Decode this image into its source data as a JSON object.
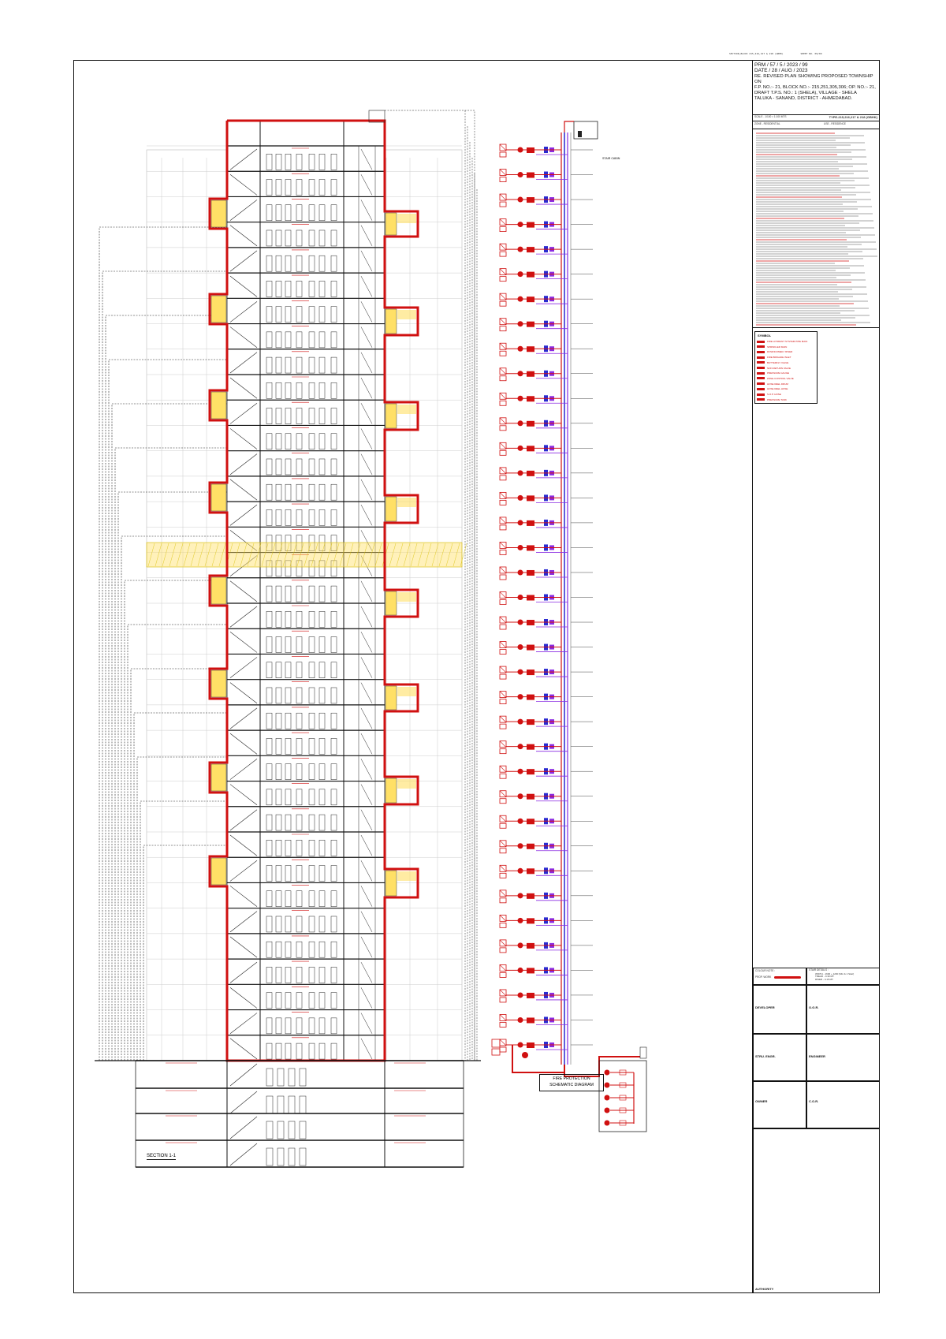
{
  "header_strip": {
    "left": "SECTION_BLOCK 215,216,217 & 218 (GBHK)",
    "right": "SHEET NO. 09/09"
  },
  "title_block": {
    "prm": "PRM / 57 / 5 / 2023 / 99",
    "date": "DATE / 28 / AUG / 2023",
    "project_lines": [
      "RE. REVISED PLAN SHOWING PROPOSED TOWNSHIP ON",
      "F.P. NO.:- 21, BLOCK NO.:- 215,251,305,306; OP. NO.:- 21,",
      "DRAFT T.P.S. NO.: 1 (SHELA), VILLAGE - SHELA",
      "TALUKA - SANAND, DISTRICT - AHMEDABAD."
    ],
    "scale": "SCALE - 1/100 = 1:100 MTS",
    "type": "TYPE-215,216,217 & 218 (GBHK)",
    "zone": "ZONE - RESIDENTIAL",
    "use": "USE - RESIDENCE",
    "colour_note_label": "COLOUR NOTE :",
    "prop_work_label": "PROP. WORK",
    "stair_details_label": "STAIR DETAILS :",
    "stair_lines": [
      "WIDTH - 1600 + 1200 (Min & 1 Stair)",
      "TREAD - 0.30 MT.",
      "RISER - 0.15 MT."
    ],
    "developer_label": "DEVELOPER",
    "developer_sign": "O.G.R.",
    "engineer_label": "STRU. ENGR.",
    "engineer_right": "ENGINEER",
    "owner_label": "OWNER",
    "owner_sign": "C.O.R.",
    "authority_label": "AUTHORITY",
    "legend_title": "SYMBOL",
    "legend_items": [
      "FIRE HYDRANT SYSTEM PIPE MAIN",
      "SPRINKLER MAIN",
      "DOWNCOMER / RISER",
      "FIRE BRIGADE INLET",
      "BUTTERFLY VALVE",
      "NON RETURN VALVE",
      "PRESSURE GAUGE",
      "ZONE CONTROL VALVE",
      "HOSE REEL DRUM",
      "HOSE REEL HOSE",
      "S.O.P. HOSE",
      "PRESSURE TANK"
    ]
  },
  "section_label": "SECTION 1-1",
  "schematic_label_1": "FIRE PROTECTION",
  "schematic_label_2": "SCHEMATIC DIAGRAM",
  "stair_cabin_label": "STAIR CABIN",
  "colors": {
    "outline": "#d01010",
    "highlight": "#ffe066",
    "pipe_blue": "#2a2ad0",
    "pipe_purple": "#8a2be2",
    "line": "#222222"
  }
}
